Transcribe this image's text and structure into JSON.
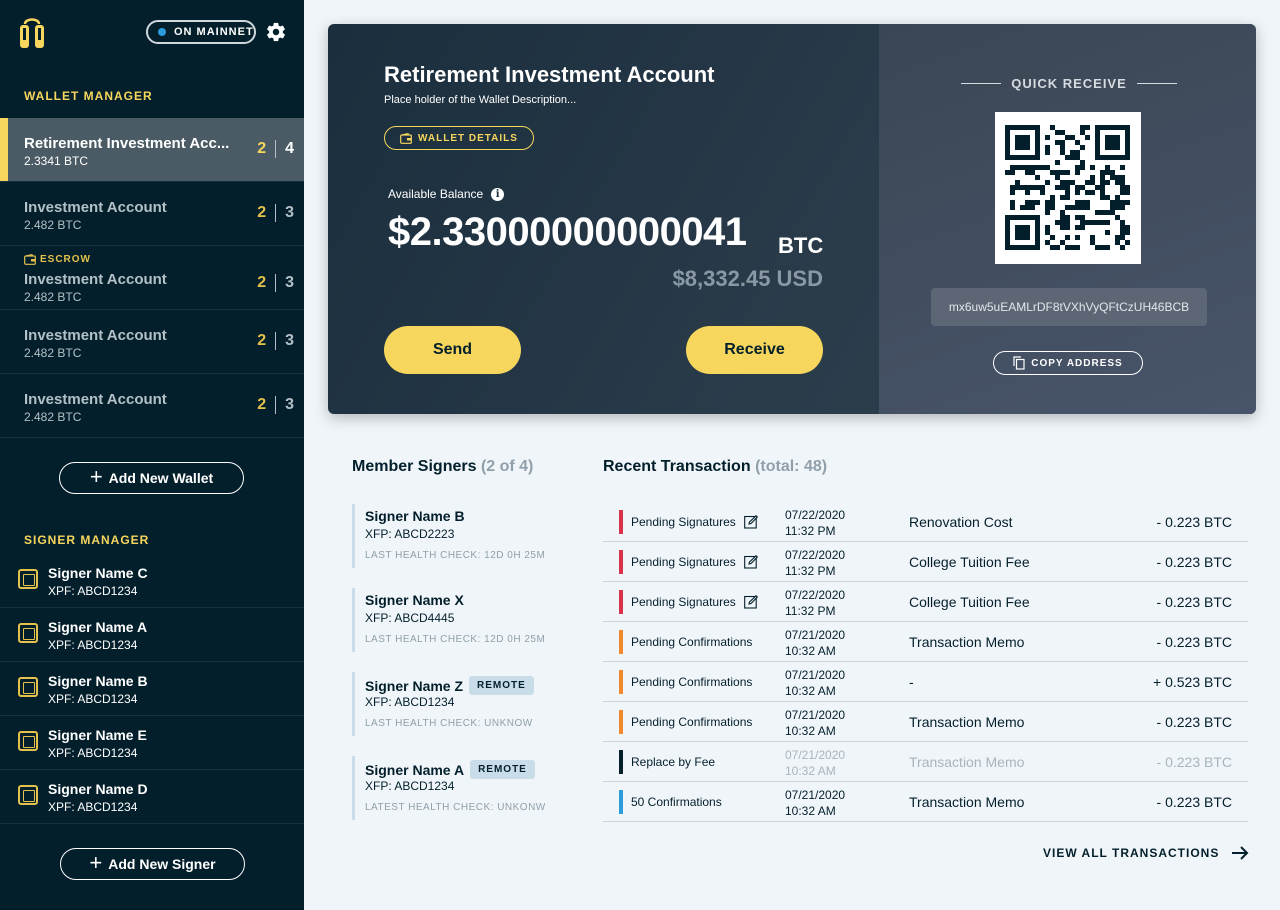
{
  "colors": {
    "sidebar_bg": "#031f2b",
    "accent_yellow": "#f6d65d",
    "network_dot": "#2d9cdb",
    "status_pending_signatures": "#d9334c",
    "status_pending_confirmations": "#f0892d",
    "status_replace_by_fee": "#031f2b",
    "status_confirmed": "#2d9cdb"
  },
  "header": {
    "network_label": "ON MAINNET",
    "settings_icon": "gear-icon"
  },
  "wallet_manager": {
    "title": "WALLET MANAGER",
    "wallets": [
      {
        "name": "Retirement Investment Acc...",
        "balance": "2.3341 BTC",
        "required": "2",
        "total": "4",
        "active": true
      },
      {
        "name": "Investment Account",
        "balance": "2.482 BTC",
        "required": "2",
        "total": "3"
      },
      {
        "name": "Investment Account",
        "balance": "2.482 BTC",
        "required": "2",
        "total": "3",
        "escrow": "ESCROW"
      },
      {
        "name": "Investment Account",
        "balance": "2.482 BTC",
        "required": "2",
        "total": "3"
      },
      {
        "name": "Investment Account",
        "balance": "2.482 BTC",
        "required": "2",
        "total": "3"
      }
    ],
    "add_label": "Add New Wallet"
  },
  "signer_manager": {
    "title": "SIGNER MANAGER",
    "signers": [
      {
        "name": "Signer Name C",
        "xfp": "XPF: ABCD1234"
      },
      {
        "name": "Signer Name A",
        "xfp": "XPF: ABCD1234"
      },
      {
        "name": "Signer Name B",
        "xfp": "XPF: ABCD1234"
      },
      {
        "name": "Signer Name E",
        "xfp": "XPF: ABCD1234"
      },
      {
        "name": "Signer Name D",
        "xfp": "XPF: ABCD1234"
      }
    ],
    "add_label": "Add New Signer"
  },
  "wallet": {
    "title": "Retirement Investment Account",
    "description": "Place holder of the Wallet Description...",
    "details_label": "WALLET DETAILS",
    "available_label": "Available Balance",
    "btc_amount": "$2.33000000000041",
    "btc_unit": "BTC",
    "usd_amount": "$8,332.45 USD",
    "send_label": "Send",
    "receive_label": "Receive"
  },
  "quick_receive": {
    "title": "QUICK RECEIVE",
    "address": "mx6uw5uEAMLrDF8tVXhVyQFtCzUH46BCB",
    "copy_label": "COPY ADDRESS"
  },
  "members": {
    "title": "Member Signers",
    "count": "(2 of 4)",
    "items": [
      {
        "name": "Signer Name B",
        "xfp": "XFP: ABCD2223",
        "health": "LAST HEALTH CHECK: 12D 0H 25M"
      },
      {
        "name": "Signer Name X",
        "xfp": "XFP: ABCD4445",
        "health": "LAST HEALTH CHECK: 12D 0H 25M"
      },
      {
        "name": "Signer Name Z",
        "xfp": "XFP: ABCD1234",
        "health": "LAST HEALTH CHECK: UNKNOW",
        "badge": "REMOTE"
      },
      {
        "name": "Signer Name A",
        "xfp": "XFP: ABCD1234",
        "health": "LATEST HEALTH CHECK: UNKONW",
        "badge": "REMOTE"
      }
    ]
  },
  "transactions": {
    "title": "Recent Transaction",
    "total": "(total: 48)",
    "rows": [
      {
        "status": "Pending Signatures",
        "kind": "sig",
        "date": "07/22/2020",
        "time": "11:32 PM",
        "memo": "Renovation Cost",
        "amount": "- 0.223 BTC",
        "editable": true
      },
      {
        "status": "Pending Signatures",
        "kind": "sig",
        "date": "07/22/2020",
        "time": "11:32 PM",
        "memo": "College Tuition Fee",
        "amount": "- 0.223 BTC",
        "editable": true
      },
      {
        "status": "Pending Signatures",
        "kind": "sig",
        "date": "07/22/2020",
        "time": "11:32 PM",
        "memo": "College Tuition Fee",
        "amount": "- 0.223 BTC",
        "editable": true
      },
      {
        "status": "Pending Confirmations",
        "kind": "conf",
        "date": "07/21/2020",
        "time": "10:32 AM",
        "memo": "Transaction Memo",
        "amount": "- 0.223 BTC"
      },
      {
        "status": "Pending Confirmations",
        "kind": "conf",
        "date": "07/21/2020",
        "time": "10:32 AM",
        "memo": "-",
        "amount": "+ 0.523 BTC"
      },
      {
        "status": "Pending Confirmations",
        "kind": "conf",
        "date": "07/21/2020",
        "time": "10:32 AM",
        "memo": "Transaction Memo",
        "amount": "- 0.223 BTC"
      },
      {
        "status": "Replace by Fee",
        "kind": "rbf",
        "date": "07/21/2020",
        "time": "10:32 AM",
        "memo": "Transaction Memo",
        "amount": "- 0.223 BTC",
        "faded": true
      },
      {
        "status": "50 Confirmations",
        "kind": "done",
        "date": "07/21/2020",
        "time": "10:32 AM",
        "memo": "Transaction Memo",
        "amount": "- 0.223 BTC"
      }
    ],
    "view_all_label": "VIEW ALL TRANSACTIONS"
  }
}
